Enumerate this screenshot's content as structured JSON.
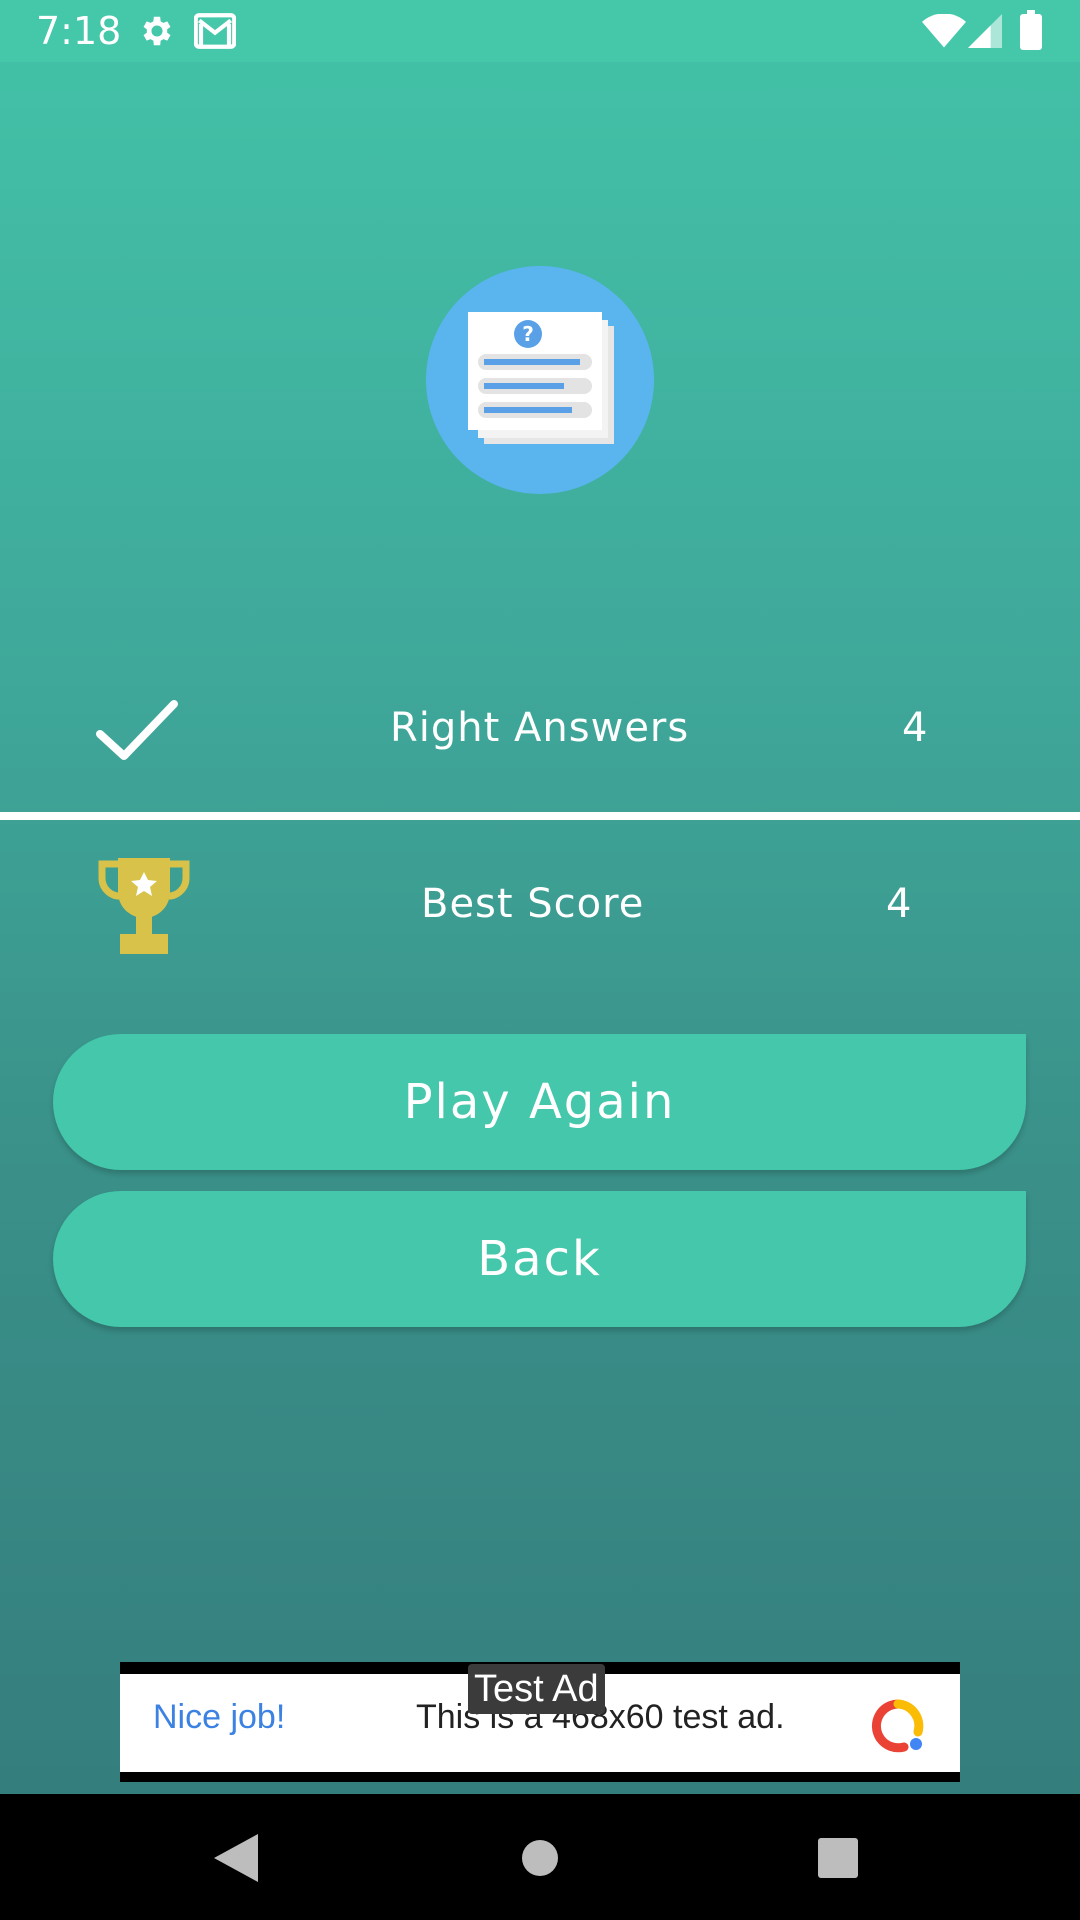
{
  "status_bar": {
    "time": "7:18",
    "icons": [
      "gear-icon",
      "gmail-icon",
      "wifi-icon",
      "signal-icon",
      "battery-icon"
    ]
  },
  "hero": {
    "icon": "quiz-document-icon",
    "circle_color": "#5ab4ee"
  },
  "results": {
    "right_answers": {
      "label": "Right Answers",
      "value": "4",
      "icon": "checkmark-icon"
    },
    "best_score": {
      "label": "Best Score",
      "value": "4",
      "icon": "trophy-icon"
    }
  },
  "buttons": {
    "play_again": "Play Again",
    "back": "Back"
  },
  "ad": {
    "badge": "Test Ad",
    "title": "Nice job!",
    "text": "This is a 468x60 test ad.",
    "icon": "adchoices-logo-icon"
  },
  "nav": {
    "icons": [
      "back-triangle-icon",
      "home-circle-icon",
      "recents-square-icon"
    ]
  },
  "colors": {
    "accent": "#44c7aa",
    "title_blue": "#3b82e3",
    "trophy": "#d8c24a"
  }
}
